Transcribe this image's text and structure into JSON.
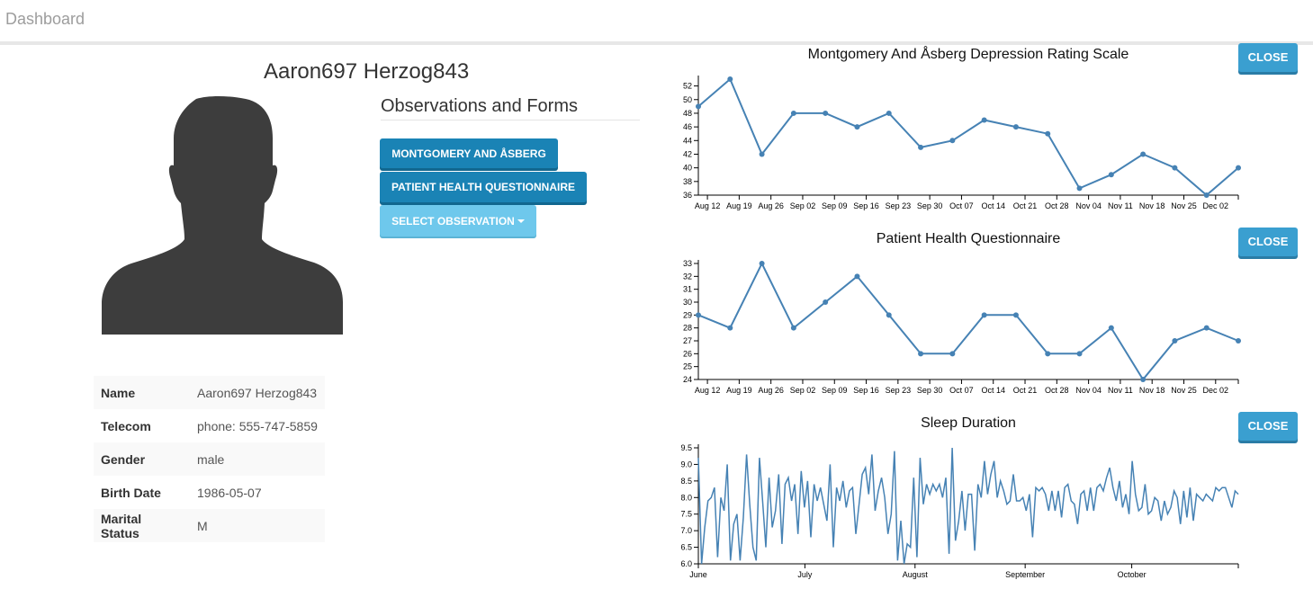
{
  "navbar": {
    "brand": "Dashboard"
  },
  "patient": {
    "name": "Aaron697 Herzog843",
    "fields": [
      {
        "label": "Name",
        "value": "Aaron697 Herzog843"
      },
      {
        "label": "Telecom",
        "value": "phone: 555-747-5859"
      },
      {
        "label": "Gender",
        "value": "male"
      },
      {
        "label": "Birth Date",
        "value": "1986-05-07"
      },
      {
        "label": "Marital Status",
        "value": "M"
      }
    ]
  },
  "observations": {
    "title": "Observations and Forms",
    "buttons": [
      "MONTGOMERY AND ÅSBERG",
      "PATIENT HEALTH QUESTIONNAIRE"
    ],
    "select_label": "SELECT OBSERVATION"
  },
  "close_label": "CLOSE",
  "colors": {
    "series": "#4682b4",
    "primary_button": "#1a83b5",
    "close_button": "#3a9fd0"
  },
  "chart_data": [
    {
      "type": "line",
      "title": "Montgomery And Åsberg Depression Rating Scale",
      "x": [
        "2019-08-10",
        "2019-08-17",
        "2019-08-24",
        "2019-08-31",
        "2019-09-07",
        "2019-09-14",
        "2019-09-21",
        "2019-09-28",
        "2019-10-05",
        "2019-10-12",
        "2019-10-19",
        "2019-10-26",
        "2019-11-02",
        "2019-11-09",
        "2019-11-16",
        "2019-11-23",
        "2019-11-30",
        "2019-12-07"
      ],
      "series": [
        {
          "values": [
            49,
            53,
            42,
            48,
            48,
            46,
            48,
            43,
            44,
            47,
            46,
            45,
            37,
            39,
            42,
            40,
            36,
            40
          ]
        }
      ],
      "x_ticks": [
        "Aug 12",
        "Aug 19",
        "Aug 26",
        "Sep 02",
        "Sep 09",
        "Sep 16",
        "Sep 23",
        "Sep 30",
        "Oct 07",
        "Oct 14",
        "Oct 21",
        "Oct 28",
        "Nov 04",
        "Nov 11",
        "Nov 18",
        "Nov 25",
        "Dec 02"
      ],
      "y_ticks": [
        "36",
        "38",
        "40",
        "42",
        "44",
        "46",
        "48",
        "50",
        "52"
      ],
      "ylim": [
        36,
        53
      ]
    },
    {
      "type": "line",
      "title": "Patient Health Questionnaire",
      "x": [
        "2019-08-10",
        "2019-08-17",
        "2019-08-24",
        "2019-08-31",
        "2019-09-07",
        "2019-09-14",
        "2019-09-21",
        "2019-09-28",
        "2019-10-05",
        "2019-10-12",
        "2019-10-19",
        "2019-10-26",
        "2019-11-02",
        "2019-11-09",
        "2019-11-16",
        "2019-11-23",
        "2019-11-30",
        "2019-12-07"
      ],
      "series": [
        {
          "values": [
            29,
            28,
            33,
            28,
            30,
            32,
            29,
            26,
            26,
            29,
            29,
            26,
            26,
            28,
            24,
            27,
            28,
            27
          ]
        }
      ],
      "x_ticks": [
        "Aug 12",
        "Aug 19",
        "Aug 26",
        "Sep 02",
        "Sep 09",
        "Sep 16",
        "Sep 23",
        "Sep 30",
        "Oct 07",
        "Oct 14",
        "Oct 21",
        "Oct 28",
        "Nov 04",
        "Nov 11",
        "Nov 18",
        "Nov 25",
        "Dec 02"
      ],
      "y_ticks": [
        "24",
        "25",
        "26",
        "27",
        "28",
        "29",
        "30",
        "31",
        "32",
        "33"
      ],
      "ylim": [
        24,
        33
      ]
    },
    {
      "type": "line",
      "title": "Sleep Duration",
      "x_start": "2019-06-01",
      "x_end": "2019-10-31",
      "series": [
        {
          "values": [
            9.2,
            6.0,
            7.1,
            7.9,
            8.0,
            8.3,
            6.2,
            8.0,
            7.6,
            9.0,
            6.1,
            7.2,
            7.5,
            6.1,
            7.4,
            9.3,
            7.8,
            6.5,
            6.1,
            9.2,
            7.9,
            6.5,
            8.6,
            7.1,
            7.6,
            8.7,
            6.6,
            8.4,
            8.6,
            7.9,
            8.4,
            6.9,
            8.8,
            7.7,
            8.5,
            6.8,
            8.4,
            7.9,
            8.3,
            7.8,
            7.3,
            9.0,
            6.5,
            8.3,
            7.9,
            8.5,
            7.7,
            8.2,
            8.3,
            6.9,
            7.8,
            8.7,
            8.9,
            8.1,
            9.3,
            7.6,
            8.2,
            8.6,
            8.0,
            6.9,
            7.5,
            9.4,
            6.1,
            7.3,
            6.0,
            6.6,
            6.5,
            8.6,
            6.2,
            9.2,
            7.8,
            8.4,
            8.1,
            8.4,
            8.2,
            8.4,
            8.0,
            8.6,
            6.3,
            9.5,
            6.7,
            7.3,
            8.2,
            7.0,
            8.1,
            8.1,
            6.4,
            8.4,
            8.0,
            9.1,
            8.1,
            8.7,
            9.1,
            8.0,
            8.5,
            8.2,
            7.8,
            7.9,
            8.7,
            7.9,
            7.9,
            8.0,
            7.6,
            8.1,
            6.8,
            8.3,
            8.2,
            8.3,
            8.1,
            7.6,
            8.2,
            7.6,
            8.2,
            7.4,
            8.3,
            8.4,
            7.9,
            7.8,
            7.2,
            8.1,
            8.2,
            7.6,
            8.3,
            7.6,
            8.3,
            8.4,
            8.2,
            8.6,
            8.9,
            8.3,
            7.9,
            8.5,
            7.7,
            8.1,
            7.5,
            9.1,
            8.1,
            7.6,
            7.7,
            8.4,
            7.5,
            7.6,
            8.0,
            7.9,
            7.3,
            7.9,
            7.5,
            7.7,
            8.2,
            8.0,
            7.2,
            8.2,
            7.4,
            8.3,
            7.3,
            8.1,
            8.0,
            7.9,
            8.1,
            8.0,
            7.9,
            8.3,
            8.2,
            8.3,
            8.3,
            8.0,
            7.7,
            8.2,
            8.1
          ]
        }
      ],
      "x_ticks": [
        "June",
        "July",
        "August",
        "September",
        "October"
      ],
      "y_ticks": [
        "6.0",
        "6.5",
        "7.0",
        "7.5",
        "8.0",
        "8.5",
        "9.0",
        "9.5"
      ],
      "ylim": [
        6.0,
        9.5
      ]
    }
  ]
}
